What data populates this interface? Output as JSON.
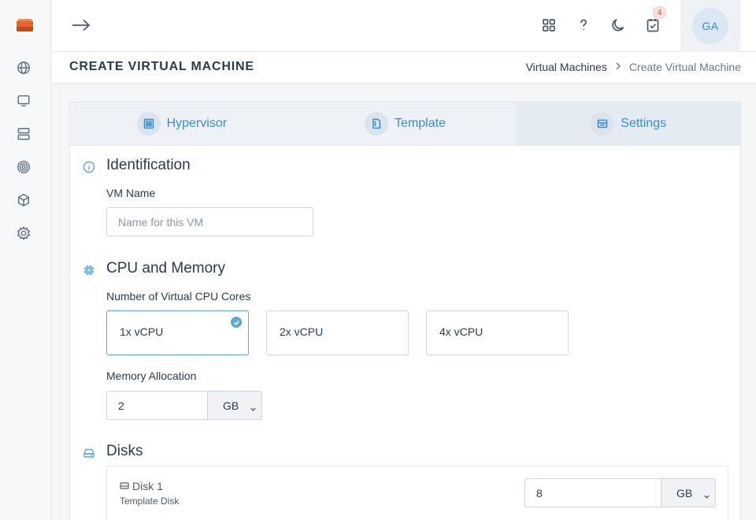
{
  "app": {
    "logo_icon": "stack-logo-icon",
    "brand_color": "#e8642a"
  },
  "sidebar": {
    "items": [
      {
        "icon": "globe-icon"
      },
      {
        "icon": "monitor-icon"
      },
      {
        "icon": "server-icon"
      },
      {
        "icon": "target-icon"
      },
      {
        "icon": "package-icon"
      },
      {
        "icon": "gear-icon"
      }
    ]
  },
  "topbar": {
    "collapse_icon": "arrow-right-icon",
    "notification_count": "4",
    "avatar_initials": "GA"
  },
  "header": {
    "title": "CREATE VIRTUAL MACHINE",
    "breadcrumb": {
      "parent": "Virtual Machines",
      "current": "Create Virtual Machine"
    }
  },
  "tabs": [
    {
      "label": "Hypervisor",
      "icon": "hypervisor-icon"
    },
    {
      "label": "Template",
      "icon": "template-icon"
    },
    {
      "label": "Settings",
      "icon": "settings-icon"
    }
  ],
  "identification": {
    "title": "Identification",
    "vm_name_label": "VM Name",
    "vm_name_value": "",
    "vm_name_placeholder": "Name for this VM"
  },
  "cpu_memory": {
    "title": "CPU and Memory",
    "cpu_label": "Number of Virtual CPU Cores",
    "cpu_options": [
      "1x vCPU",
      "2x vCPU",
      "4x vCPU"
    ],
    "cpu_selected": "1x vCPU",
    "memory_label": "Memory Allocation",
    "memory_value": "2",
    "memory_unit": "GB"
  },
  "disks": {
    "title": "Disks",
    "items": [
      {
        "name": "Disk 1",
        "subtitle": "Template Disk",
        "size": "8",
        "unit": "GB"
      }
    ]
  },
  "colors": {
    "accent": "#3a8bc9",
    "section_icon": "#5aa7d8"
  }
}
